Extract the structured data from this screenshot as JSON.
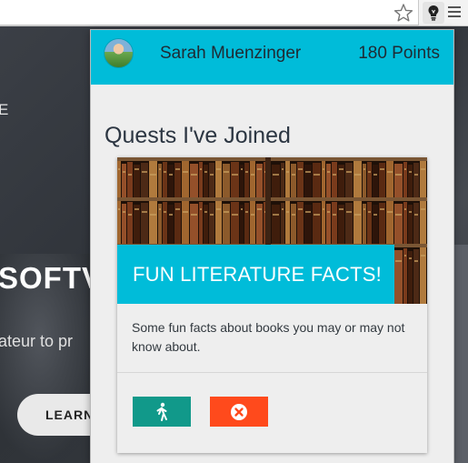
{
  "browser": {
    "icons": [
      "star-icon",
      "lightbulb-icon",
      "menu-icon"
    ]
  },
  "background_page": {
    "fragment_e": "E",
    "fragment_heading": "SOFTV",
    "fragment_subtext": "ateur to pr",
    "learn_button": "LEARN"
  },
  "popup": {
    "user_name": "Sarah Muenzinger",
    "points": "180 Points",
    "section_title": "Quests I've Joined",
    "quest": {
      "title": "FUN LITERATURE FACTS!",
      "description": "Some fun facts about books you may or may not know about.",
      "join_icon": "walking-person-icon",
      "leave_icon": "close-circle-icon"
    }
  },
  "colors": {
    "header": "#00bcd9",
    "join_button": "#11998a",
    "leave_button": "#ff4a1c"
  }
}
